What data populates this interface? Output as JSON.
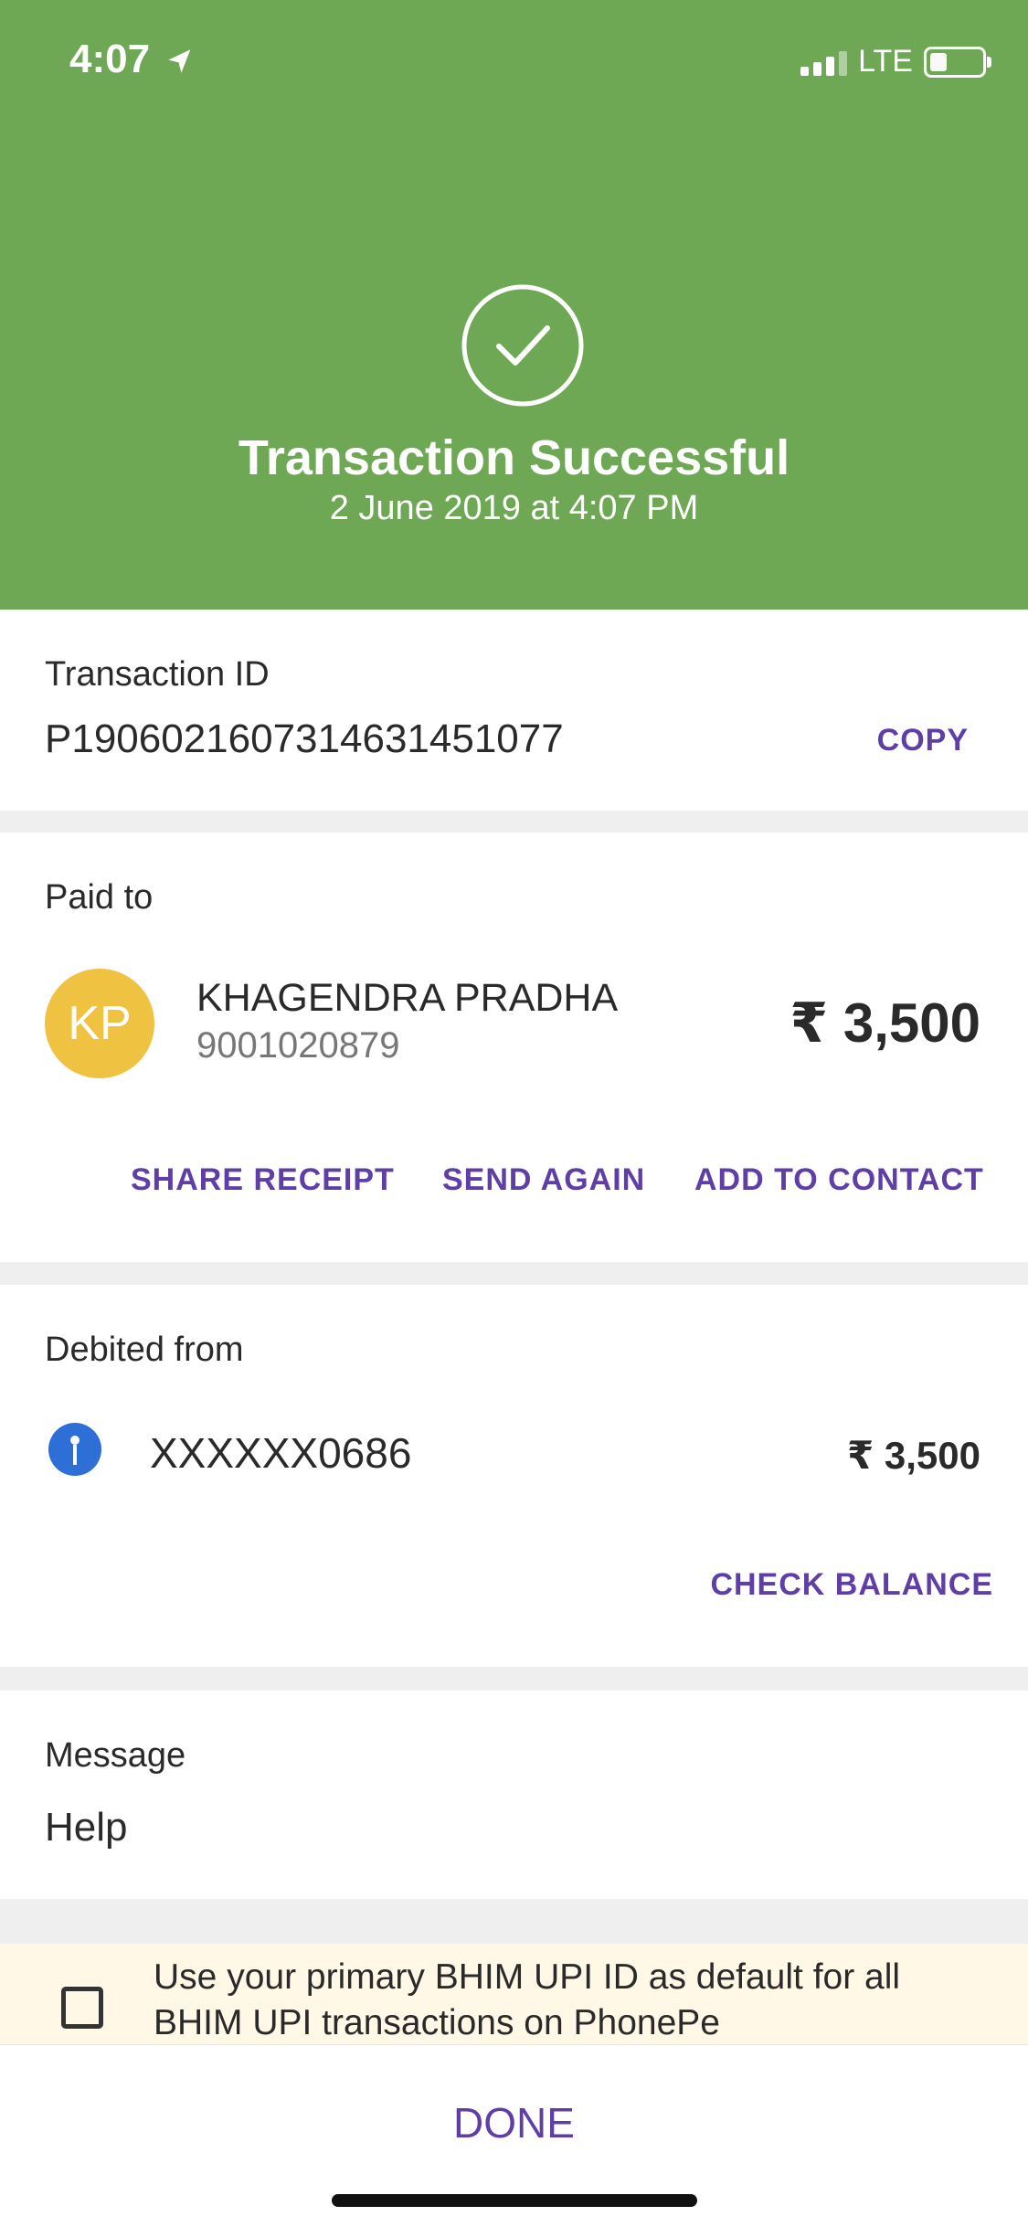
{
  "status_bar": {
    "time": "4:07",
    "network": "LTE"
  },
  "header": {
    "title": "Transaction Successful",
    "subtitle": "2 June 2019 at 4:07 PM",
    "icon": "check-circle-icon",
    "color": "#6fa855"
  },
  "transaction": {
    "label": "Transaction ID",
    "id": "P1906021607314631451077",
    "copy_label": "COPY"
  },
  "paid_to": {
    "label": "Paid to",
    "initials": "KP",
    "name": "KHAGENDRA PRADHA",
    "phone": "9001020879",
    "amount": "₹ 3,500",
    "actions": {
      "share": "SHARE RECEIPT",
      "send_again": "SEND AGAIN",
      "add_contact": "ADD TO CONTACT"
    }
  },
  "debited_from": {
    "label": "Debited from",
    "account": "XXXXXX0686",
    "amount": "₹ 3,500",
    "check_balance": "CHECK BALANCE"
  },
  "message": {
    "label": "Message",
    "text": "Help"
  },
  "notice": {
    "text": "Use your primary BHIM UPI ID as default for all BHIM UPI transactions on PhonePe"
  },
  "footer": {
    "done_label": "DONE"
  },
  "colors": {
    "accent": "#5f3ea8",
    "avatar": "#f0c242",
    "bank": "#2d6fd6"
  }
}
